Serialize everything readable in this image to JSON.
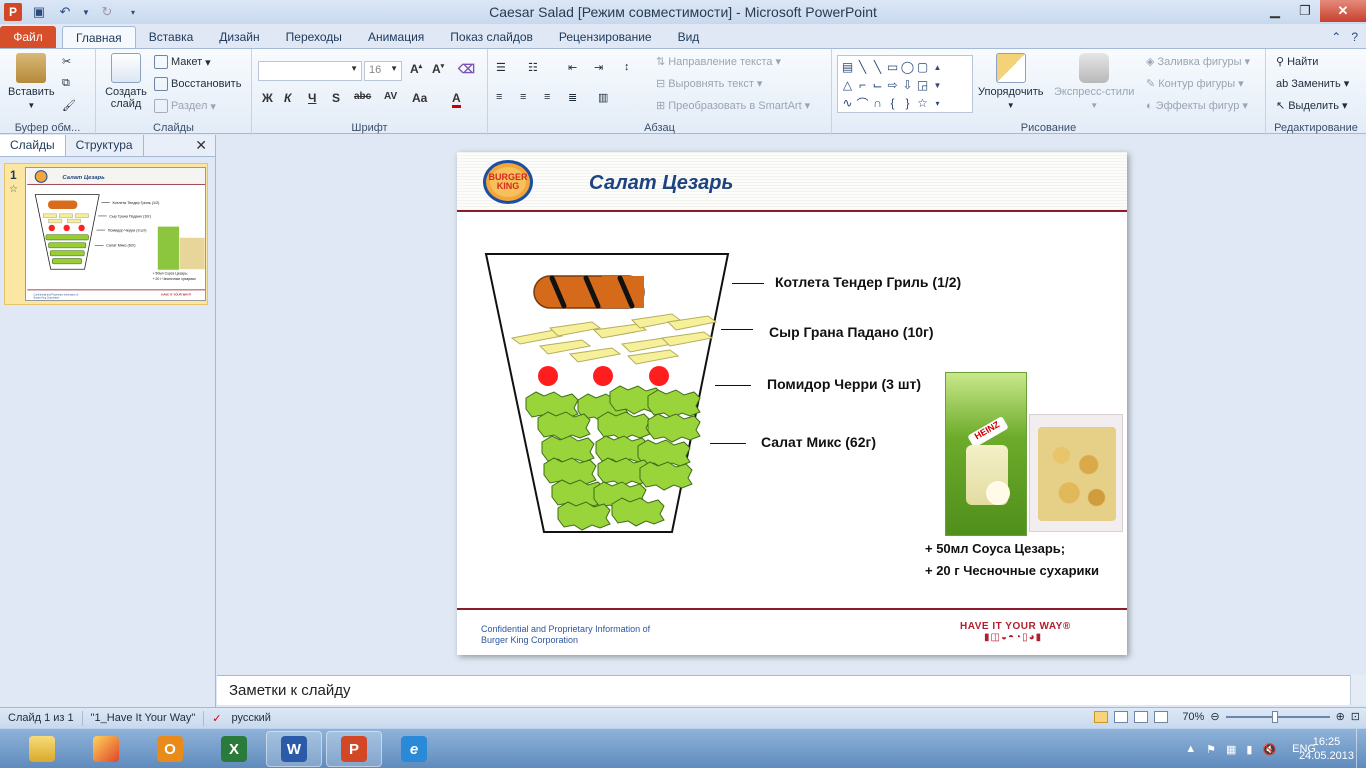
{
  "window": {
    "title": "Caesar Salad [Режим совместимости]  -  Microsoft PowerPoint",
    "app_icon_letter": "P"
  },
  "ribbon_tabs": {
    "file": "Файл",
    "items": [
      "Главная",
      "Вставка",
      "Дизайн",
      "Переходы",
      "Анимация",
      "Показ слайдов",
      "Рецензирование",
      "Вид"
    ],
    "active": "Главная"
  },
  "ribbon": {
    "clipboard": {
      "paste": "Вставить",
      "label": "Буфер обм..."
    },
    "slides": {
      "new_slide": "Создать слайд",
      "layout": "Макет",
      "reset": "Восстановить",
      "section": "Раздел",
      "label": "Слайды"
    },
    "font": {
      "name": "",
      "size": "16",
      "label": "Шрифт"
    },
    "paragraph": {
      "text_direction": "Направление текста",
      "align_text": "Выровнять текст",
      "smartart": "Преобразовать в SmartArt",
      "label": "Абзац"
    },
    "drawing": {
      "arrange": "Упорядочить",
      "quick_styles": "Экспресс-стили",
      "shape_fill": "Заливка фигуры",
      "shape_outline": "Контур фигуры",
      "shape_effects": "Эффекты фигур",
      "label": "Рисование"
    },
    "editing": {
      "find": "Найти",
      "replace": "Заменить",
      "select": "Выделить",
      "label": "Редактирование"
    }
  },
  "left_pane": {
    "tab_slides": "Слайды",
    "tab_outline": "Структура",
    "slide_number": "1"
  },
  "slide": {
    "title": "Салат Цезарь",
    "logo_text": [
      "BURGER",
      "KING"
    ],
    "labels": {
      "cutlet": "Котлета  Тендер Гриль (1/2)",
      "cheese": "Сыр Грана Падано (10г)",
      "tomato": "Помидор Черри (3 шт)",
      "salad": "Салат Микс (62г)"
    },
    "extras": [
      "+ 50мл Соуса  Цезарь;",
      "+ 20 г Чесночные сухарики"
    ],
    "sauce_brand": "HEINZ",
    "footer": [
      "Confidential and Proprietary Information of",
      "Burger King Corporation"
    ],
    "slogan": "HAVE IT YOUR WAY®"
  },
  "notes": {
    "placeholder": "Заметки к слайду"
  },
  "statusbar": {
    "slide_info": "Слайд 1 из 1",
    "theme": "\"1_Have It Your Way\"",
    "language": "русский",
    "zoom": "70%"
  },
  "taskbar": {
    "language": "ENG",
    "time": "16:25",
    "date": "24.05.2013"
  },
  "colors": {
    "accent_red": "#8b1a2b",
    "title_blue": "#1d4380",
    "lettuce": "#9acd32",
    "tomato": "#ff2020",
    "cheese": "#f5ee9a"
  }
}
